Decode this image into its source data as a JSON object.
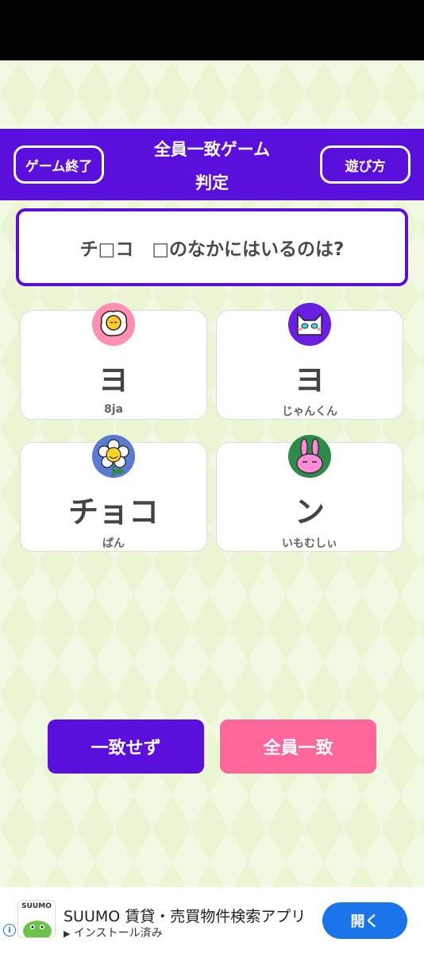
{
  "header": {
    "end_button": "ゲーム終了",
    "title_line1": "全員一致ゲーム",
    "title_line2": "判定",
    "howto_button": "遊び方"
  },
  "question": "チ□コ　□のなかにはいるのは?",
  "answers": [
    {
      "answer": "ヨ",
      "player": "8ja",
      "avatar": "fried-egg-icon"
    },
    {
      "answer": "ヨ",
      "player": "じゃんくん",
      "avatar": "cat-icon"
    },
    {
      "answer": "チョコ",
      "player": "ぱん",
      "avatar": "flower-icon"
    },
    {
      "answer": "ン",
      "player": "いもむしぃ",
      "avatar": "rabbit-icon"
    }
  ],
  "actions": {
    "no_match": "一致せず",
    "all_match": "全員一致"
  },
  "ad": {
    "logo_text": "SUUMO",
    "title": "SUUMO 賃貸・売買物件検索アプリ",
    "subtitle": "インストール済み",
    "open_button": "開く"
  },
  "colors": {
    "primary": "#5a0fdc",
    "accent": "#ff6699",
    "background": "#eaf6d3",
    "ad_button": "#1a73e8"
  }
}
